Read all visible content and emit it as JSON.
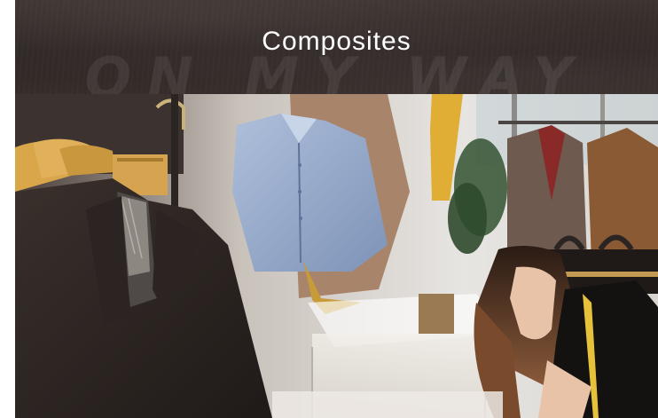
{
  "banner": {
    "title": "Composites",
    "watermark": "ON MY WAY"
  },
  "photo": {
    "alt": "Fashion boutique with suits on hangers, shirts on display and a tailor measuring fabric"
  },
  "colors": {
    "banner_bg": "#2f2725",
    "title_text": "#ffffff",
    "page_bg": "#ffffff"
  }
}
